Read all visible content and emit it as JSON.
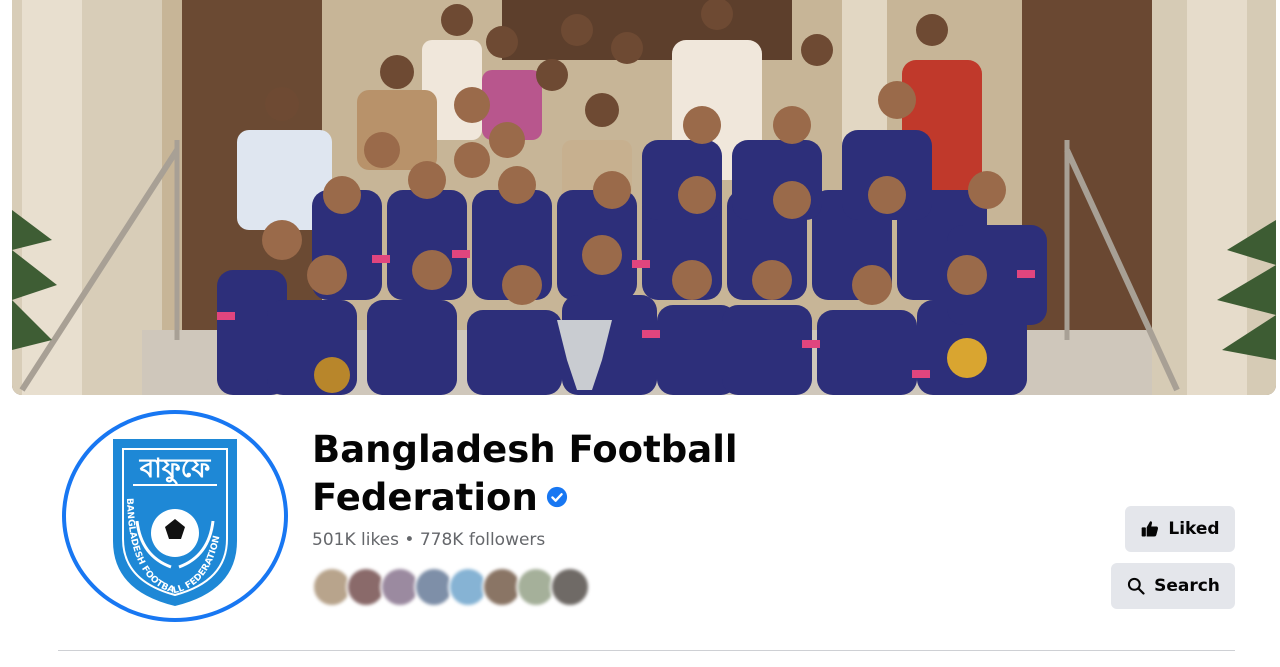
{
  "cover": {
    "alt_icon": "team-group-photo"
  },
  "profile": {
    "logo_icon": "bff-crest-icon",
    "logo_text_top": "বাফুফে",
    "logo_text_ring": "BANGLADESH FOOTBALL FEDERATION",
    "name": "Bangladesh Football Federation",
    "verified_icon": "verified-badge-icon",
    "stats": "501K likes • 778K followers"
  },
  "followers_preview": {
    "count_shown": 8
  },
  "actions": {
    "liked_label": "Liked",
    "liked_icon": "thumbs-up-icon",
    "search_label": "Search",
    "search_icon": "search-icon"
  },
  "colors": {
    "accent": "#1877f2",
    "button_bg": "#e4e6eb",
    "text_primary": "#050505",
    "text_secondary": "#65676b"
  }
}
